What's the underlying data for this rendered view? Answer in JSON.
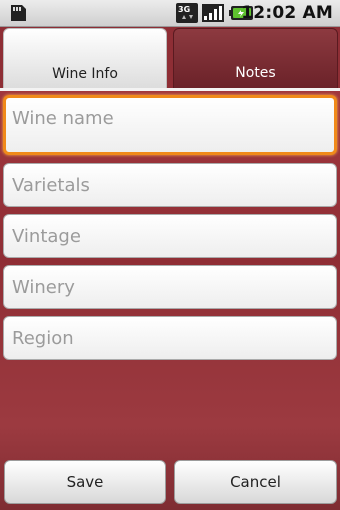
{
  "status_bar": {
    "time": "12:02 AM",
    "network_label": "3G",
    "icons": [
      "sd-card-icon",
      "network-3g-icon",
      "signal-strength-icon",
      "battery-icon"
    ]
  },
  "tabs": [
    {
      "label": "Wine Info",
      "selected": true
    },
    {
      "label": "Notes",
      "selected": false
    }
  ],
  "form": {
    "wine_name": {
      "placeholder": "Wine name",
      "value": ""
    },
    "varietals": {
      "placeholder": "Varietals",
      "value": ""
    },
    "vintage": {
      "placeholder": "Vintage",
      "value": ""
    },
    "winery": {
      "placeholder": "Winery",
      "value": ""
    },
    "region": {
      "placeholder": "Region",
      "value": ""
    }
  },
  "buttons": {
    "save_label": "Save",
    "cancel_label": "Cancel"
  },
  "colors": {
    "background": "#8e2e35",
    "focus_border": "#f08a1a",
    "placeholder_text": "#9b9b9b"
  }
}
